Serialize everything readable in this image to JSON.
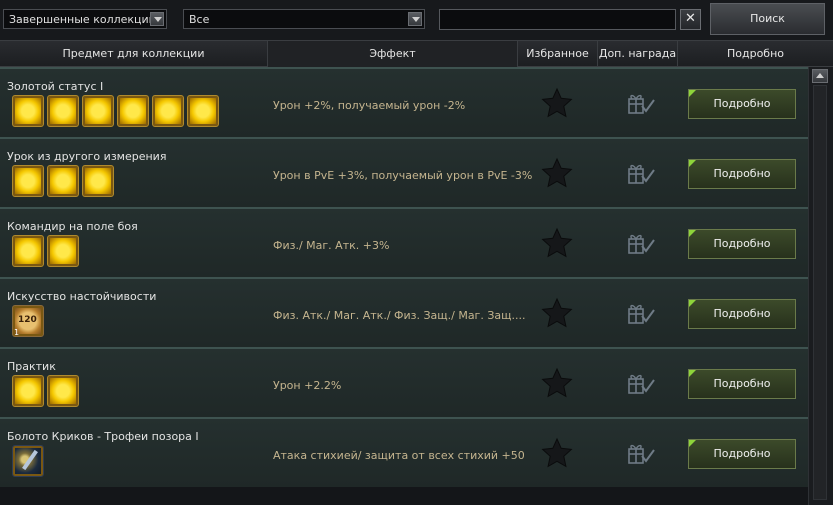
{
  "filters": {
    "collection_filter": "Завершенные коллекции",
    "category_filter": "Все",
    "search_value": "",
    "clear_label": "✕",
    "search_button": "Поиск"
  },
  "columns": [
    "Предмет для коллекции",
    "Эффект",
    "Избранное",
    "Доп. награда",
    "Подробно"
  ],
  "rows": [
    {
      "name": "Золотой статус I",
      "effect": "Урон +2%, получаемый урон -2%",
      "items": [
        "gold",
        "gold",
        "gold",
        "gold",
        "gold",
        "gold"
      ],
      "favorite": false,
      "detail": "Подробно"
    },
    {
      "name": "Урок из другого измерения",
      "effect": "Урон в PvE +3%, получаемый урон в PvE -3%",
      "items": [
        "gold",
        "gold",
        "gold"
      ],
      "favorite": false,
      "detail": "Подробно"
    },
    {
      "name": "Командир на поле боя",
      "effect": "Физ./ Маг. Атк. +3%",
      "items": [
        "gold",
        "gold"
      ],
      "favorite": false,
      "detail": "Подробно"
    },
    {
      "name": "Искусство настойчивости",
      "effect": "Физ. Атк./ Маг. Атк./ Физ. Защ./ Маг. Защ....",
      "items": [
        "coin"
      ],
      "coin_label": "120",
      "coin_count": "1",
      "favorite": false,
      "detail": "Подробно"
    },
    {
      "name": "Практик",
      "effect": "Урон +2.2%",
      "items": [
        "gold",
        "gold"
      ],
      "favorite": false,
      "detail": "Подробно"
    },
    {
      "name": "Болото Криков - Трофеи позора I",
      "effect": "Атака стихией/ защита от всех стихий +50",
      "items": [
        "blue"
      ],
      "favorite": false,
      "detail": "Подробно"
    }
  ],
  "colors": {
    "accent_green": "#8ed43a",
    "effect_text": "#c5b58f",
    "row_border": "#3e5350"
  },
  "icons": {
    "favorite": "star-icon",
    "bonus": "gift-check-icon",
    "dropdown": "chevron-down-icon",
    "clear": "close-icon",
    "scroll_up": "scroll-up-icon"
  }
}
